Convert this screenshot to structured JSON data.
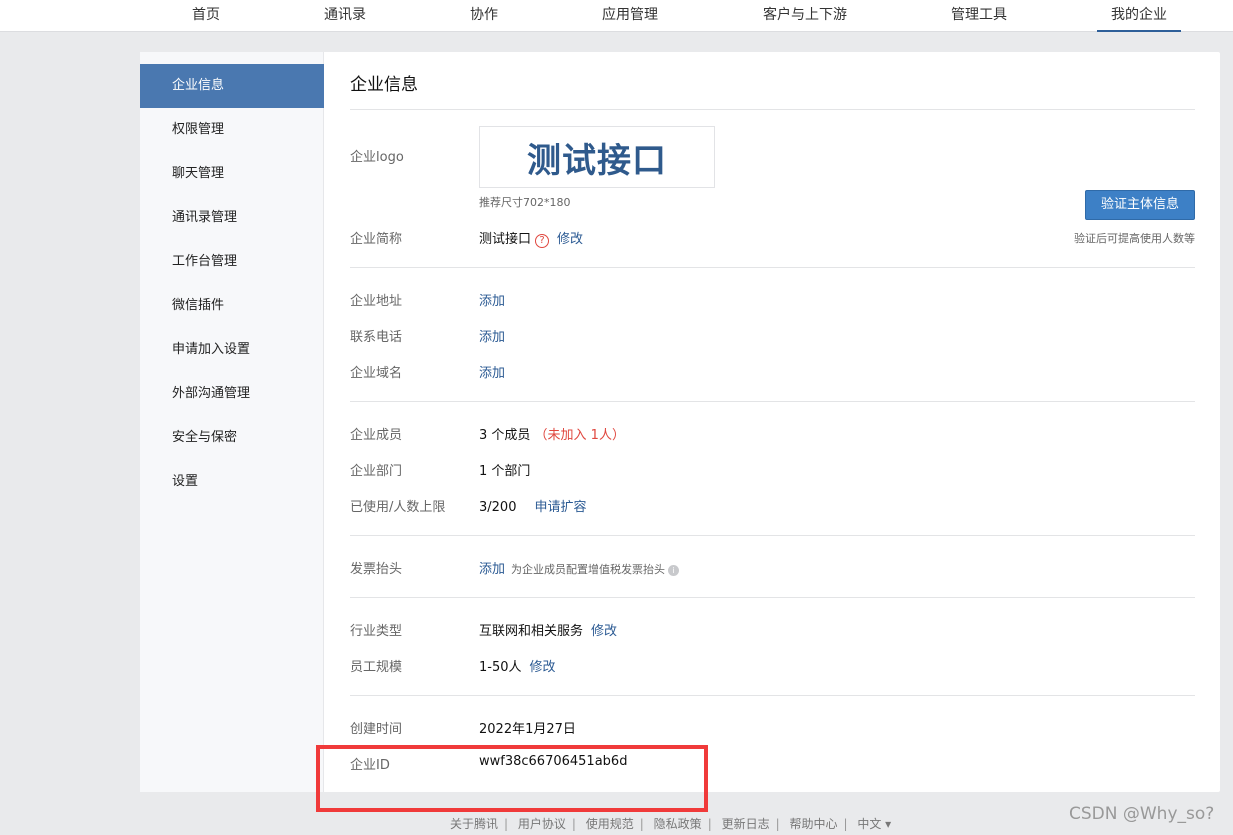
{
  "nav": [
    "首页",
    "通讯录",
    "协作",
    "应用管理",
    "客户与上下游",
    "管理工具",
    "我的企业"
  ],
  "sidebar": [
    "企业信息",
    "权限管理",
    "聊天管理",
    "通讯录管理",
    "工作台管理",
    "微信插件",
    "申请加入设置",
    "外部沟通管理",
    "安全与保密",
    "设置"
  ],
  "title": "企业信息",
  "logo": {
    "label": "企业logo",
    "text": "测试接口",
    "hint": "推荐尺寸702*180"
  },
  "verify": {
    "button": "验证主体信息",
    "hint": "验证后可提高使用人数等"
  },
  "short_name": {
    "label": "企业简称",
    "value": "测试接口",
    "help": "?",
    "edit": "修改"
  },
  "address": {
    "label": "企业地址",
    "value": "添加"
  },
  "phone": {
    "label": "联系电话",
    "value": "添加"
  },
  "domain": {
    "label": "企业域名",
    "value": "添加"
  },
  "members": {
    "label": "企业成员",
    "value": "3 个成员",
    "pending": "（未加入 1人）"
  },
  "depts": {
    "label": "企业部门",
    "value": "1 个部门"
  },
  "limit": {
    "label": "已使用/人数上限",
    "value": "3/200",
    "action": "申请扩容"
  },
  "invoice": {
    "label": "发票抬头",
    "value": "添加",
    "hint": "为企业成员配置增值税发票抬头",
    "info": "i"
  },
  "industry": {
    "label": "行业类型",
    "value": "互联网和相关服务",
    "edit": "修改"
  },
  "scale": {
    "label": "员工规模",
    "value": "1-50人",
    "edit": "修改"
  },
  "created": {
    "label": "创建时间",
    "value": "2022年1月27日"
  },
  "corp_id": {
    "label": "企业ID",
    "value": "wwf38c66706451ab6d"
  },
  "footer": [
    "关于腾讯",
    "用户协议",
    "使用规范",
    "隐私政策",
    "更新日志",
    "帮助中心",
    "中文 ▾"
  ],
  "watermark": "CSDN @Why_so?"
}
